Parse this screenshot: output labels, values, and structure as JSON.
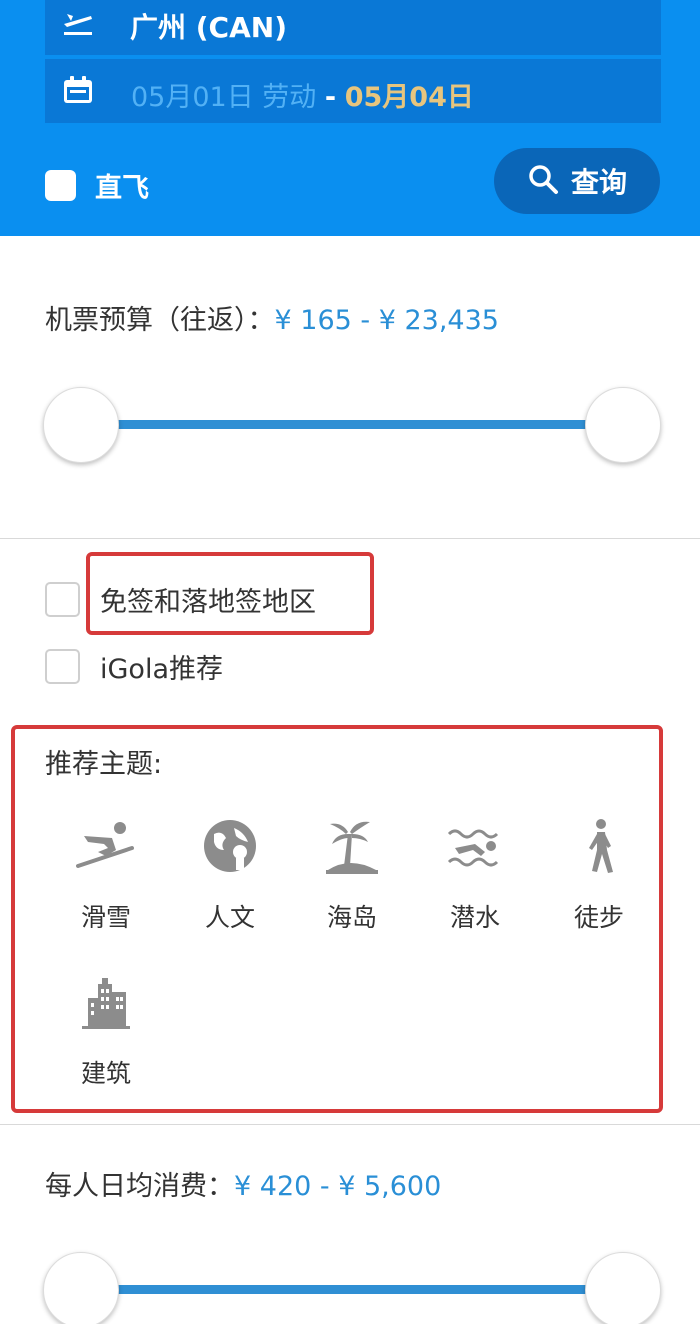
{
  "header": {
    "city": "广州 (CAN)",
    "city_icon": "plane-departure-icon",
    "date_start": "05月01日 劳动",
    "date_separator": "-",
    "date_end": "05月04日",
    "date_icon": "calendar-icon",
    "direct_flight_label": "直飞",
    "direct_flight_checked": false,
    "search_button_label": "查询",
    "search_icon": "search-icon"
  },
  "budget": {
    "label": "机票预算（往返）：",
    "range": "¥ 165 - ¥ 23,435",
    "min_fraction": 0.0,
    "max_fraction": 1.0
  },
  "filters": [
    {
      "label": "免签和落地签地区",
      "checked": false
    },
    {
      "label": "iGola推荐",
      "checked": false
    }
  ],
  "themes": {
    "title": "推荐主题:",
    "items": [
      {
        "label": "滑雪",
        "icon": "skiing-icon"
      },
      {
        "label": "人文",
        "icon": "globe-culture-icon"
      },
      {
        "label": "海岛",
        "icon": "palm-island-icon"
      },
      {
        "label": "潜水",
        "icon": "swimming-diving-icon"
      },
      {
        "label": "徒步",
        "icon": "hiking-person-icon"
      },
      {
        "label": "建筑",
        "icon": "building-icon"
      }
    ]
  },
  "daily_spend": {
    "label": "每人日均消费：",
    "range": "¥ 420 - ¥ 5,600",
    "min_fraction": 0.0,
    "max_fraction": 1.0
  },
  "colors": {
    "header_bg": "#0a8ff0",
    "field_bg": "#0a78d6",
    "accent_price": "#2a8fd6",
    "date_end": "#e7c57e",
    "highlight_red": "#d63a3a",
    "icon_gray": "#8c8c8c"
  }
}
